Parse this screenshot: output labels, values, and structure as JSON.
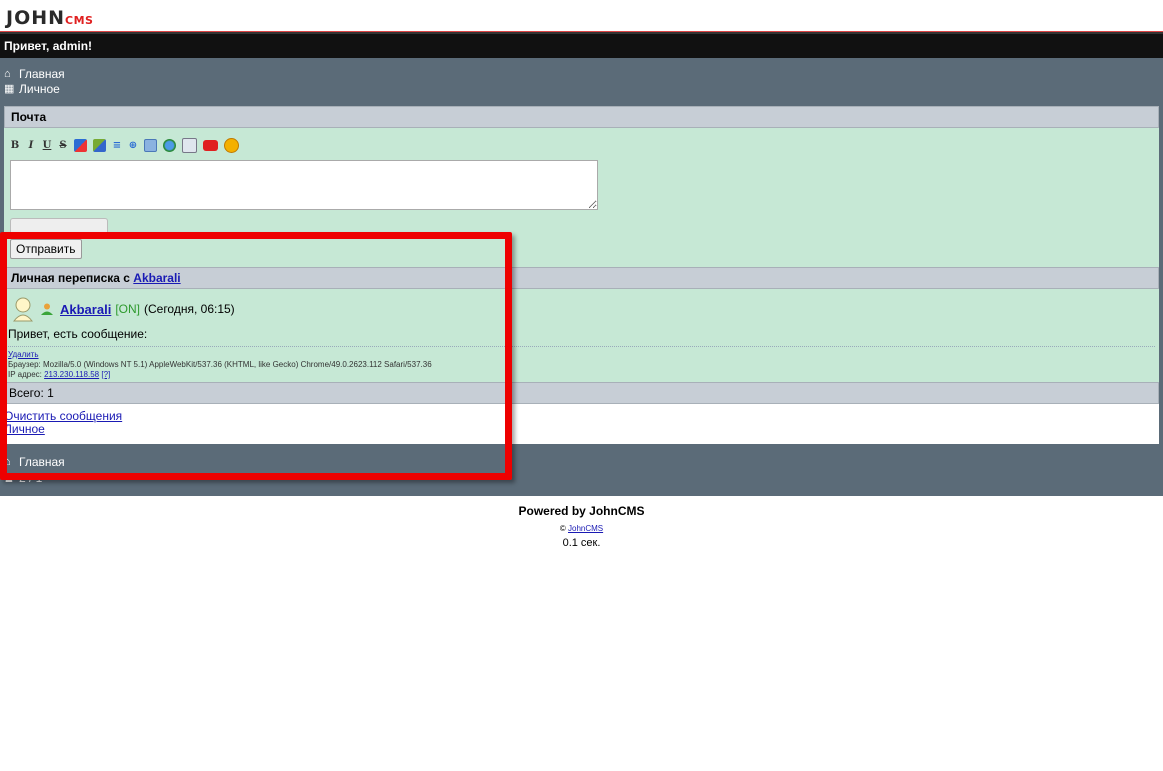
{
  "app": {
    "logo_main": "JOHN",
    "logo_sub": "CMS"
  },
  "header": {
    "greeting": "Привет, admin!"
  },
  "nav": {
    "items": [
      {
        "label": "Главная",
        "icon": "home-icon"
      },
      {
        "label": "Личное",
        "icon": "grid-icon"
      }
    ]
  },
  "compose": {
    "title": "Почта",
    "toolbar": [
      {
        "label": "B",
        "icon": "bold-icon"
      },
      {
        "label": "I",
        "icon": "italic-icon"
      },
      {
        "label": "U",
        "icon": "underline-icon"
      },
      {
        "label": "S",
        "icon": "strike-icon"
      },
      {
        "label": "",
        "icon": "text-color-icon"
      },
      {
        "label": "",
        "icon": "bg-color-icon"
      },
      {
        "label": "",
        "icon": "list-icon"
      },
      {
        "label": "",
        "icon": "spoiler-icon"
      },
      {
        "label": "",
        "icon": "quote-icon"
      },
      {
        "label": "",
        "icon": "url-icon"
      },
      {
        "label": "",
        "icon": "image-icon"
      },
      {
        "label": "",
        "icon": "youtube-icon"
      },
      {
        "label": "",
        "icon": "smile-icon"
      }
    ],
    "message_value": "",
    "send_label": "Отправить"
  },
  "conversation": {
    "title_prefix": "Личная переписка с ",
    "title_user": "Akbarali",
    "messages": [
      {
        "user": "Akbarali",
        "status": "[ON]",
        "time": "(Сегодня, 06:15)",
        "text": "Привет, есть сообщение:",
        "delete_label": "Удалить",
        "browser_label": "Браузер:",
        "browser": "Mozilla/5.0 (Windows NT 5.1) AppleWebKit/537.36 (KHTML, like Gecko) Chrome/49.0.2623.112 Safari/537.36",
        "ip_label": "IP адрес:",
        "ip": "213.230.118.58",
        "ip_help": "[?]"
      }
    ],
    "total": "Всего: 1",
    "links": [
      "Очистить сообщения",
      "Личное"
    ]
  },
  "footer_nav": {
    "home": "Главная",
    "online": "2 / 1"
  },
  "footer": {
    "powered": "Powered by JohnCMS",
    "copy_symbol": "©",
    "copy_link": "JohnCMS",
    "gen_time": "0.1 сек."
  },
  "colors": {
    "header_bg": "#111111",
    "nav_bg": "#5b6b78",
    "panel_green": "#c6e8d5",
    "phdr_bg": "#c7ced6",
    "highlight": "#ee0000"
  }
}
